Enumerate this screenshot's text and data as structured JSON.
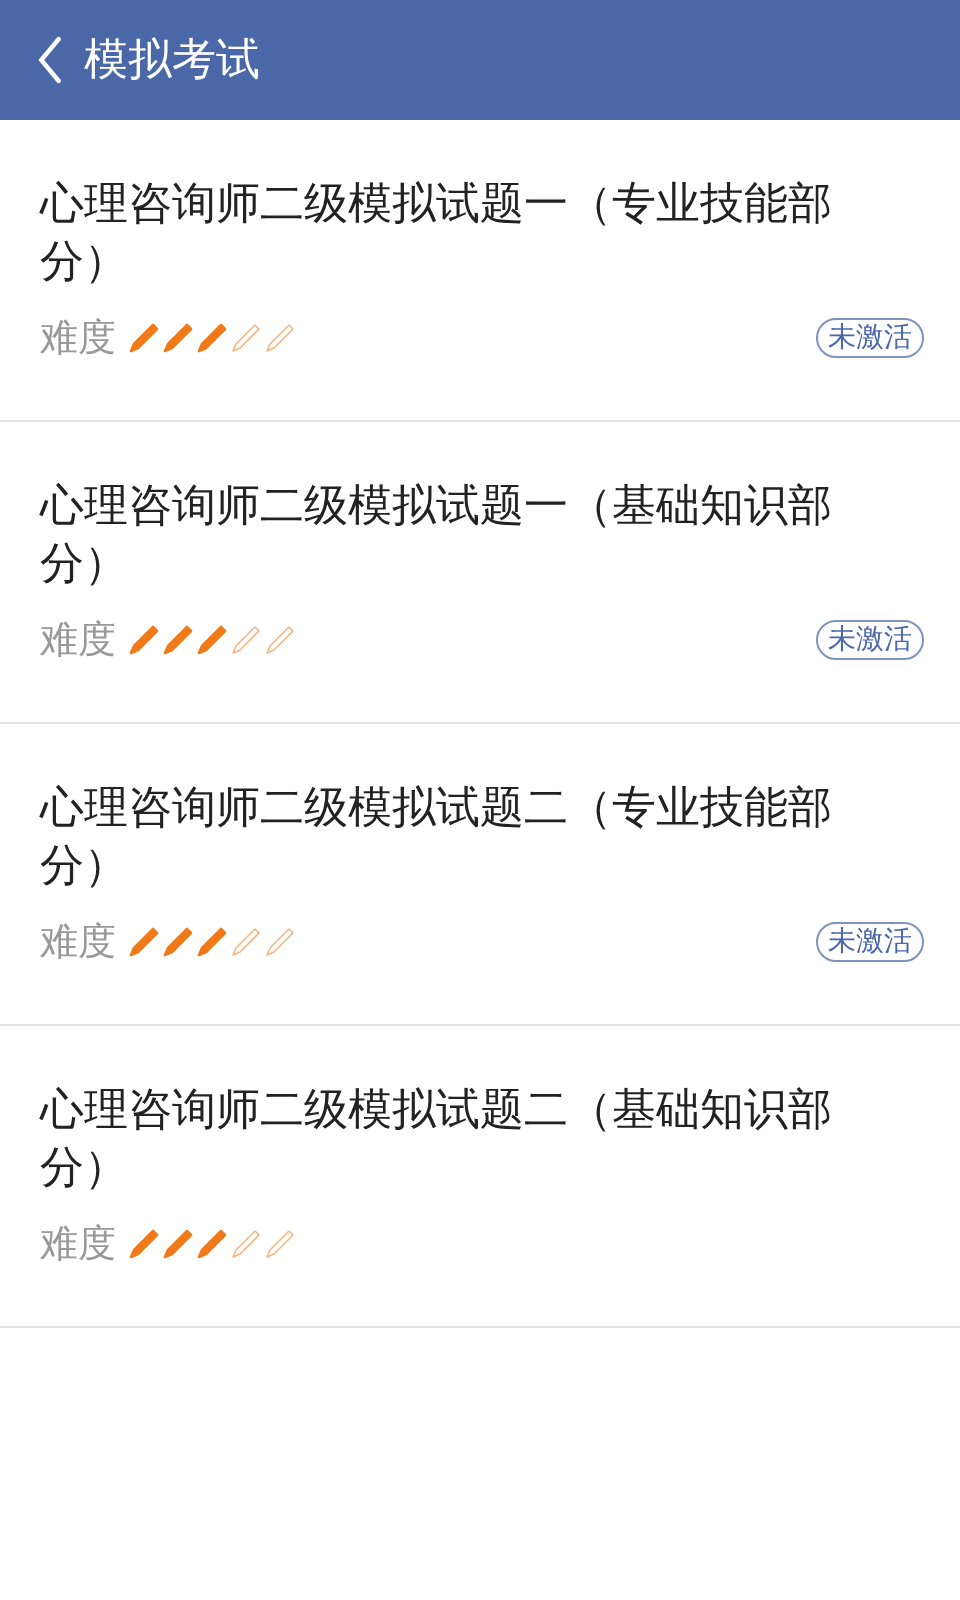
{
  "header": {
    "title": "模拟考试"
  },
  "exams": [
    {
      "title": "心理咨询师二级模拟试题一（专业技能部分）",
      "difficulty_label": "难度",
      "stars": 3,
      "badge": "未激活"
    },
    {
      "title": "心理咨询师二级模拟试题一（基础知识部分）",
      "difficulty_label": "难度",
      "stars": 3,
      "badge": "未激活"
    },
    {
      "title": "心理咨询师二级模拟试题二（专业技能部分）",
      "difficulty_label": "难度",
      "stars": 3,
      "badge": "未激活"
    },
    {
      "title": "心理咨询师二级模拟试题二（基础知识部分）",
      "difficulty_label": "难度",
      "stars": 3
    }
  ]
}
